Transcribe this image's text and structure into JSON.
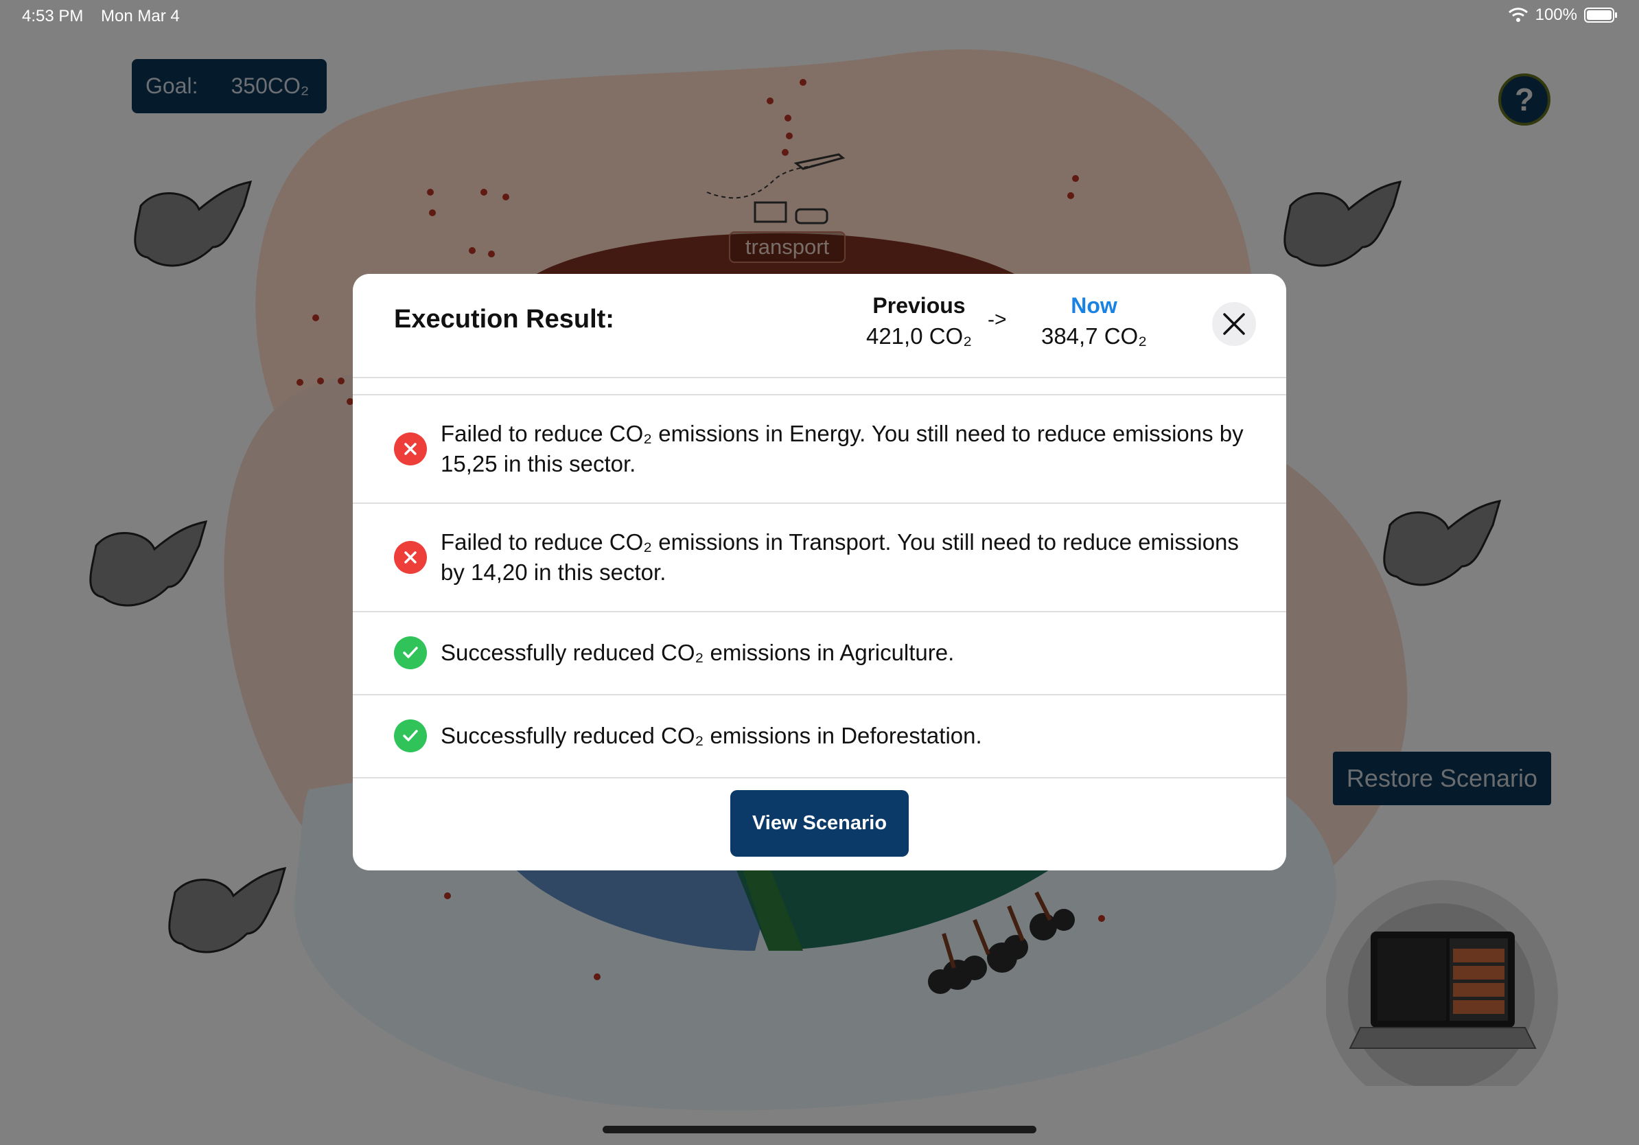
{
  "status_bar": {
    "time": "4:53 PM",
    "date": "Mon Mar 4",
    "battery": "100%"
  },
  "goal": {
    "label": "Goal:",
    "value": "350CO₂"
  },
  "help": {
    "label": "?"
  },
  "scene": {
    "transport_label": "transport"
  },
  "restore_button": {
    "label": "Restore Scenario"
  },
  "modal": {
    "title": "Execution Result:",
    "previous_label": "Previous",
    "previous_value": "421,0 CO₂",
    "arrow": "->",
    "now_label": "Now",
    "now_value": "384,7 CO₂",
    "results": [
      {
        "status": "fail",
        "icon": "x-circle-icon",
        "text": "Failed to reduce CO₂ emissions in Energy. You still need to reduce emissions by 15,25 in this sector."
      },
      {
        "status": "fail",
        "icon": "x-circle-icon",
        "text": "Failed to reduce CO₂ emissions in Transport. You still need to reduce emissions by 14,20 in this sector."
      },
      {
        "status": "success",
        "icon": "check-circle-icon",
        "text": "Successfully reduced CO₂ emissions in Agriculture."
      },
      {
        "status": "success",
        "icon": "check-circle-icon",
        "text": "Successfully reduced CO₂ emissions in Deforestation."
      }
    ],
    "view_button": "View Scenario"
  },
  "colors": {
    "accent_blue": "#1a82e3",
    "fail_red": "#ee3e3a",
    "success_green": "#2fc35a",
    "button_navy": "#0b3a68"
  }
}
